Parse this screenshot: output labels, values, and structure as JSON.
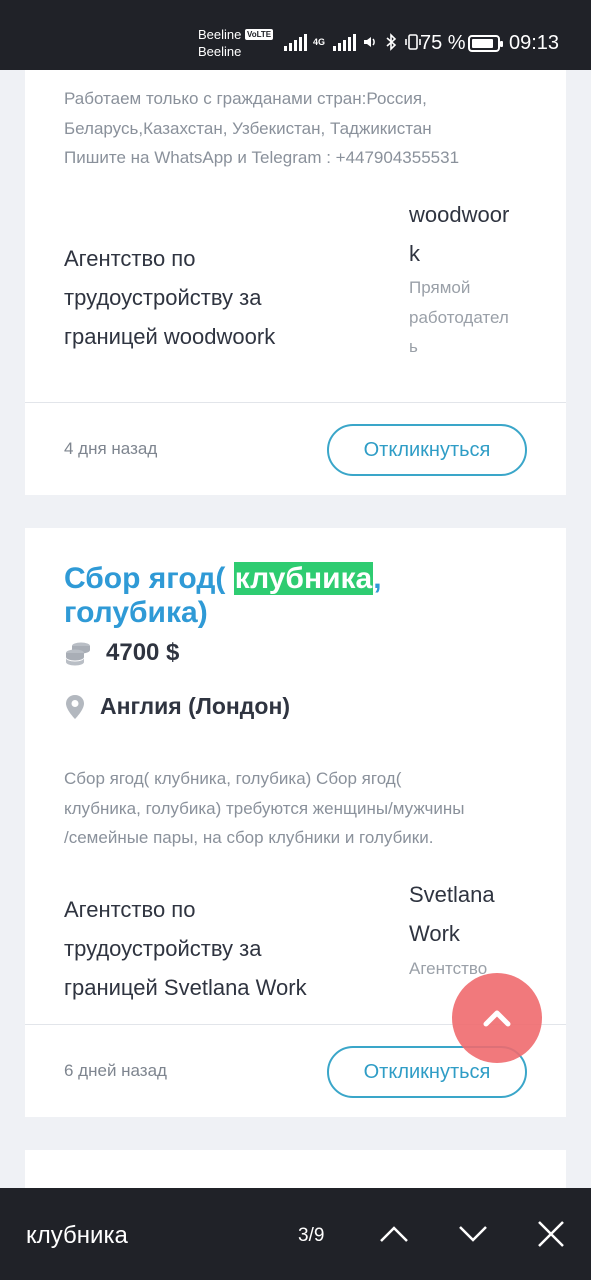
{
  "status_bar": {
    "carrier_1": "Beeline",
    "volte_badge": "VoLTE",
    "carrier_2": "Beeline",
    "network_type": "4G",
    "battery_percent": "75 %",
    "time": "09:13"
  },
  "listings": [
    {
      "description_lines": [
        "Работаем только с гражданами стран:Россия,",
        "Беларусь,Казахстан, Узбекистан, Таджикистан",
        "Пишите на WhatsApp и Telegram : +447904355531"
      ],
      "agency_lines": [
        "Агентство по",
        "трудоустройству за",
        "границей woodwoork"
      ],
      "employer_name_lines": [
        "woodwoor",
        "k"
      ],
      "employer_type_lines": [
        "Прямой",
        "работодател",
        "ь"
      ],
      "posted": "4 дня назад",
      "respond_label": "Откликнуться"
    },
    {
      "title_before": "Сбор ягод( ",
      "title_highlight": "клубника",
      "title_after": ",",
      "title_line2": "голубика)",
      "salary": "4700 $",
      "location": "Англия (Лондон)",
      "description_lines": [
        "Сбор ягод( клубника, голубика) Сбор ягод(",
        "клубника, голубика) требуются женщины/мужчины",
        "/семейные пары, на сбор клубники и голубики."
      ],
      "agency_lines": [
        "Агентство по",
        "трудоустройству за",
        "границей Svetlana Work"
      ],
      "employer_name_lines": [
        "Svetlana",
        "Work"
      ],
      "employer_type": "Агентство",
      "posted": "6 дней назад",
      "respond_label": "Откликнуться"
    }
  ],
  "find_bar": {
    "query": "клубника",
    "match_counter": "3/9"
  },
  "colors": {
    "accent_blue": "#2f9ad6",
    "highlight_green": "#2ecc71",
    "fab_red": "#f06a6e",
    "bar_dark": "#202228"
  },
  "icons": [
    "coins-icon",
    "location-pin-icon",
    "chevron-up-icon",
    "chevron-down-icon",
    "close-icon"
  ]
}
